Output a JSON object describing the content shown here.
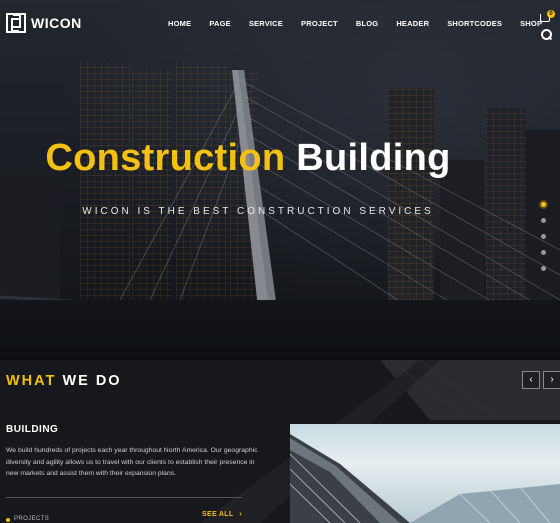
{
  "brand": {
    "name": "WICON"
  },
  "nav": {
    "items": [
      "HOME",
      "PAGE",
      "SERVICE",
      "PROJECT",
      "BLOG",
      "HEADER",
      "SHORTCODES",
      "SHOP"
    ],
    "cart_count": "0",
    "icons": {
      "logo": "wicon-logo-mark",
      "cart": "cart-icon",
      "search": "search-icon"
    }
  },
  "hero": {
    "title_accent": "Construction",
    "title_rest": "Building",
    "subtitle": "WICON IS THE BEST CONSTRUCTION SERVICES",
    "slide_count": 5,
    "active_slide": 1
  },
  "what_we_do": {
    "title_accent": "WHAT",
    "title_rest": "WE DO",
    "card": {
      "title": "BUILDING",
      "text": "We build hundreds of projects each year throughout North America. Our geographic diversity and agility allows us to travel with our clients to establish their presence in new markets and assist them with their expansion plans.",
      "see_all": "SEE ALL",
      "category": "PROJECTS"
    }
  },
  "colors": {
    "accent": "#f4c10f",
    "dark": "#16181b"
  }
}
